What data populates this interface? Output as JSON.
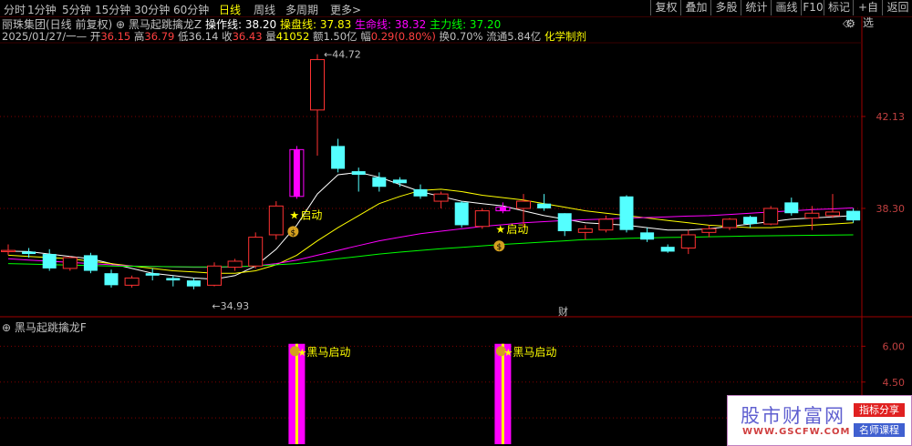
{
  "toolbar": {
    "tabs": [
      "分时",
      "1分钟",
      "5分钟",
      "15分钟",
      "30分钟",
      "60分钟",
      "日线",
      "周线",
      "多周期",
      "更多>"
    ],
    "active_tab": "日线",
    "right_buttons": [
      "复权",
      "叠加",
      "多股",
      "统计",
      "画线",
      "F10",
      "标记",
      "+自选",
      "返回"
    ]
  },
  "header": {
    "stock": "丽珠集团(日线 前复权)",
    "indicator": "黑马起跳擒龙Z",
    "lines": [
      {
        "label": "操作线:",
        "value": "38.20",
        "color": "#ffffff"
      },
      {
        "label": "操盘线:",
        "value": "37.83",
        "color": "#ffff00"
      },
      {
        "label": "生命线:",
        "value": "38.32",
        "color": "#ff00ff"
      },
      {
        "label": "主力线:",
        "value": "37.20",
        "color": "#00ff00"
      }
    ],
    "right_icons": [
      "gear-icon",
      "diamond-icon"
    ]
  },
  "info": {
    "date": "2025/01/27/一",
    "open_label": "开",
    "open": "36.15",
    "high_label": "高",
    "high": "36.79",
    "low_label": "低",
    "low": "36.14",
    "close_label": "收",
    "close": "36.43",
    "vol_label": "量",
    "vol": "41052",
    "amount_label": "额",
    "amount": "1.50亿",
    "change_label": "幅",
    "change": "0.29(0.80%)",
    "turnover_label": "换",
    "turnover": "0.70%",
    "float_label": "流通",
    "float": "5.84亿",
    "sector": "化学制剂"
  },
  "chart_data": [
    {
      "type": "candlestick",
      "title": "黑马起跳擒龙Z",
      "y_ticks": [
        38.3,
        42.13
      ],
      "ylim": [
        33.9,
        45.2
      ],
      "max_label": "44.72",
      "min_label": "34.93",
      "signal_label": "启动",
      "finance_marker": "财",
      "candles": [
        {
          "o": 36.5,
          "h": 36.8,
          "c": 36.55,
          "l": 36.35
        },
        {
          "o": 36.5,
          "h": 36.65,
          "c": 36.4,
          "l": 36.25
        },
        {
          "o": 36.4,
          "h": 36.6,
          "c": 35.8,
          "l": 35.7
        },
        {
          "o": 35.8,
          "h": 36.3,
          "c": 36.25,
          "l": 35.7
        },
        {
          "o": 36.35,
          "h": 36.45,
          "c": 35.7,
          "l": 35.6
        },
        {
          "o": 35.6,
          "h": 35.75,
          "c": 35.1,
          "l": 35.0
        },
        {
          "o": 35.1,
          "h": 35.5,
          "c": 35.4,
          "l": 35.0
        },
        {
          "o": 35.6,
          "h": 35.8,
          "c": 35.5,
          "l": 35.3
        },
        {
          "o": 35.4,
          "h": 35.5,
          "c": 35.3,
          "l": 35.05
        },
        {
          "o": 35.3,
          "h": 35.4,
          "c": 35.05,
          "l": 34.93
        },
        {
          "o": 35.1,
          "h": 36.05,
          "c": 35.9,
          "l": 35.05
        },
        {
          "o": 35.85,
          "h": 36.2,
          "c": 36.1,
          "l": 35.7
        },
        {
          "o": 35.9,
          "h": 37.3,
          "c": 37.1,
          "l": 35.8
        },
        {
          "o": 37.2,
          "h": 38.6,
          "c": 38.4,
          "l": 37.0
        },
        {
          "o": 38.8,
          "h": 40.9,
          "c": 40.75,
          "l": 38.7
        },
        {
          "o": 42.4,
          "h": 44.72,
          "c": 44.5,
          "l": 40.5
        },
        {
          "o": 40.9,
          "h": 41.2,
          "c": 39.95,
          "l": 39.8
        },
        {
          "o": 39.85,
          "h": 40.0,
          "c": 39.7,
          "l": 39.0
        },
        {
          "o": 39.6,
          "h": 39.8,
          "c": 39.2,
          "l": 39.0
        },
        {
          "o": 39.5,
          "h": 39.6,
          "c": 39.35,
          "l": 39.2
        },
        {
          "o": 39.1,
          "h": 39.3,
          "c": 38.8,
          "l": 38.7
        },
        {
          "o": 38.6,
          "h": 39.0,
          "c": 38.9,
          "l": 38.3
        },
        {
          "o": 38.55,
          "h": 38.6,
          "c": 37.6,
          "l": 37.5
        },
        {
          "o": 37.55,
          "h": 38.3,
          "c": 38.2,
          "l": 37.45
        },
        {
          "o": 38.2,
          "h": 38.55,
          "c": 38.35,
          "l": 38.1
        },
        {
          "o": 38.3,
          "h": 38.9,
          "c": 38.6,
          "l": 37.5
        },
        {
          "o": 38.5,
          "h": 38.9,
          "c": 38.3,
          "l": 38.2
        },
        {
          "o": 38.1,
          "h": 38.1,
          "c": 37.35,
          "l": 37.15
        },
        {
          "o": 37.3,
          "h": 37.6,
          "c": 37.45,
          "l": 37.0
        },
        {
          "o": 37.4,
          "h": 38.0,
          "c": 37.85,
          "l": 37.3
        },
        {
          "o": 38.8,
          "h": 38.85,
          "c": 37.4,
          "l": 37.3
        },
        {
          "o": 37.3,
          "h": 37.5,
          "c": 37.0,
          "l": 36.9
        },
        {
          "o": 36.7,
          "h": 36.8,
          "c": 36.5,
          "l": 36.45
        },
        {
          "o": 36.65,
          "h": 37.4,
          "c": 37.2,
          "l": 36.4
        },
        {
          "o": 37.3,
          "h": 37.6,
          "c": 37.45,
          "l": 37.1
        },
        {
          "o": 37.5,
          "h": 37.9,
          "c": 37.85,
          "l": 37.4
        },
        {
          "o": 37.95,
          "h": 38.0,
          "c": 37.65,
          "l": 37.5
        },
        {
          "o": 37.65,
          "h": 38.4,
          "c": 38.3,
          "l": 37.6
        },
        {
          "o": 38.55,
          "h": 38.75,
          "c": 38.1,
          "l": 38.0
        },
        {
          "o": 37.9,
          "h": 38.4,
          "c": 38.1,
          "l": 37.4
        },
        {
          "o": 38.0,
          "h": 38.9,
          "c": 38.15,
          "l": 37.9
        },
        {
          "o": 38.2,
          "h": 38.3,
          "c": 37.8,
          "l": 37.7
        }
      ],
      "signals_at": [
        14,
        24
      ],
      "series": [
        {
          "name": "操作线",
          "color": "#ffffff",
          "values": [
            36.52,
            36.5,
            36.4,
            36.3,
            36.2,
            36.0,
            35.8,
            35.6,
            35.5,
            35.4,
            35.35,
            35.5,
            35.9,
            36.6,
            37.6,
            38.9,
            39.7,
            39.8,
            39.6,
            39.3,
            39.0,
            38.8,
            38.6,
            38.5,
            38.4,
            38.2,
            38.0,
            37.85,
            37.7,
            37.65,
            37.6,
            37.5,
            37.4,
            37.4,
            37.45,
            37.55,
            37.65,
            37.75,
            37.85,
            37.9,
            37.95,
            38.0
          ]
        },
        {
          "name": "操盘线",
          "color": "#ffff00",
          "values": [
            36.35,
            36.3,
            36.25,
            36.2,
            36.1,
            36.0,
            35.9,
            35.8,
            35.7,
            35.65,
            35.6,
            35.6,
            35.7,
            35.95,
            36.35,
            36.95,
            37.5,
            38.0,
            38.5,
            38.8,
            39.05,
            39.1,
            39.0,
            38.85,
            38.75,
            38.65,
            38.5,
            38.35,
            38.2,
            38.1,
            38.0,
            37.9,
            37.8,
            37.7,
            37.6,
            37.55,
            37.5,
            37.5,
            37.55,
            37.6,
            37.65,
            37.7
          ]
        },
        {
          "name": "生命线",
          "color": "#ff00ff",
          "values": [
            36.2,
            36.15,
            36.1,
            36.05,
            36.0,
            35.95,
            35.9,
            35.88,
            35.86,
            35.85,
            35.85,
            35.86,
            35.9,
            36.0,
            36.15,
            36.35,
            36.55,
            36.75,
            36.95,
            37.1,
            37.25,
            37.35,
            37.45,
            37.55,
            37.62,
            37.7,
            37.75,
            37.8,
            37.83,
            37.86,
            37.9,
            37.92,
            37.95,
            37.98,
            38.0,
            38.05,
            38.1,
            38.15,
            38.2,
            38.25,
            38.28,
            38.32
          ]
        },
        {
          "name": "主力线",
          "color": "#00ff00",
          "values": [
            36.0,
            35.98,
            35.96,
            35.94,
            35.92,
            35.9,
            35.89,
            35.88,
            35.87,
            35.86,
            35.86,
            35.87,
            35.9,
            35.95,
            36.0,
            36.1,
            36.2,
            36.3,
            36.4,
            36.48,
            36.55,
            36.62,
            36.68,
            36.74,
            36.8,
            36.85,
            36.9,
            36.95,
            37.0,
            37.02,
            37.05,
            37.07,
            37.09,
            37.1,
            37.12,
            37.13,
            37.15,
            37.16,
            37.17,
            37.18,
            37.19,
            37.2
          ]
        }
      ]
    },
    {
      "type": "bar",
      "title": "黑马起跳擒龙F",
      "y_ticks": [
        3.0,
        4.5,
        6.0
      ],
      "ylim": [
        1.9,
        6.7
      ],
      "signal_label": "黑马启动",
      "signals_at": [
        14,
        24
      ],
      "bar_value": 6.1
    }
  ],
  "ad": {
    "title": "股市财富网",
    "url": "WWW.GSCFW.COM",
    "badge1": "指标分享",
    "badge2": "名师课程"
  }
}
